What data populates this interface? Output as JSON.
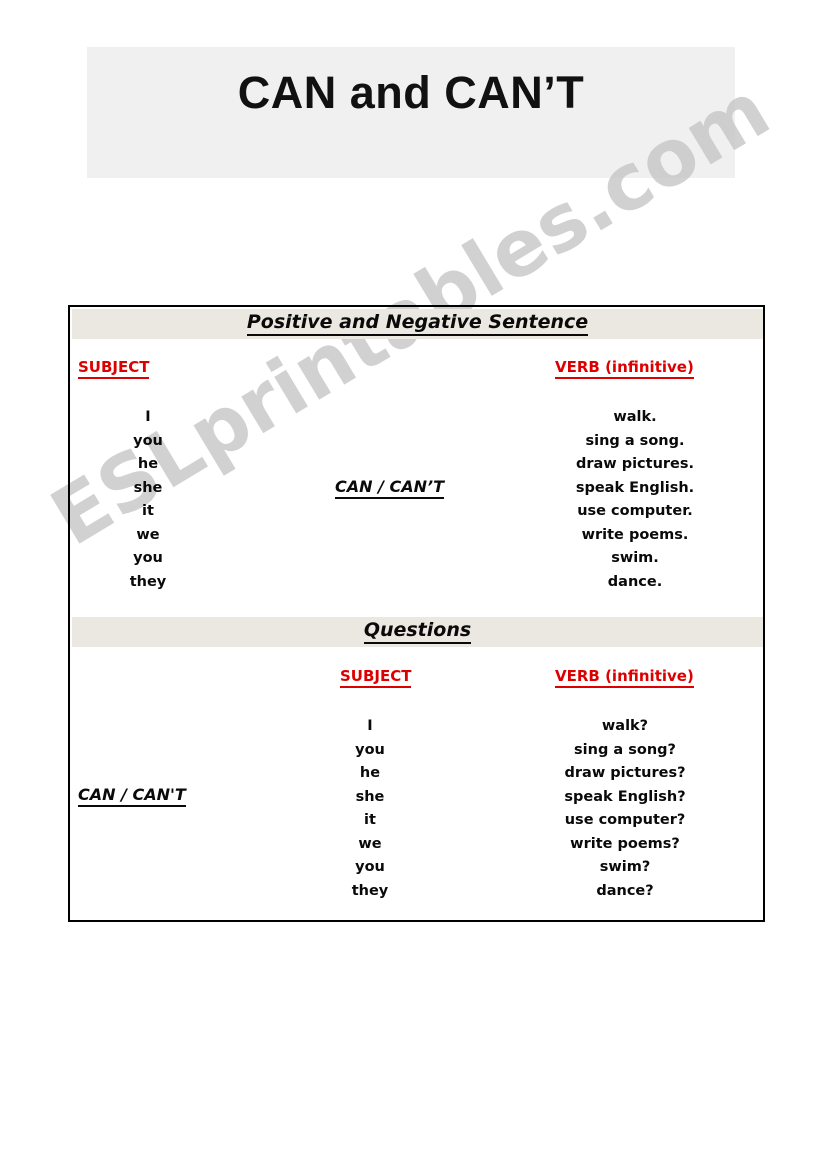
{
  "page": {
    "title": "CAN and CAN’T"
  },
  "watermark": {
    "text": "ESLprintables.com"
  },
  "colors": {
    "title_background": "#f0f0f0",
    "band_background": "#eae8e1",
    "header_red": "#dd0000",
    "text_black": "#0a0a0a",
    "watermark_gray": "#c9c9c9",
    "table_border": "#000000"
  },
  "table": {
    "sections": [
      {
        "id": "positive",
        "band_label": "Positive and Negative Sentence",
        "subject_header": "SUBJECT",
        "verb_header_main": "VERB",
        "verb_header_paren": "(infinitive)",
        "modal_label": "CAN / CAN’T",
        "subjects": [
          "I",
          "you",
          "he",
          "she",
          "it",
          "we",
          "you",
          "they"
        ],
        "verbs": [
          "walk.",
          "sing a song.",
          "draw pictures.",
          "speak English.",
          "use computer.",
          "write poems.",
          "swim.",
          "dance."
        ]
      },
      {
        "id": "questions",
        "band_label": "Questions",
        "subject_header": "SUBJECT",
        "verb_header_main": "VERB",
        "verb_header_paren": "(infinitive)",
        "modal_label": "CAN / CAN'T",
        "subjects": [
          "I",
          "you",
          "he",
          "she",
          "it",
          "we",
          "you",
          "they"
        ],
        "verbs": [
          "walk?",
          "sing a song?",
          "draw pictures?",
          "speak English?",
          "use computer?",
          "write poems?",
          "swim?",
          "dance?"
        ]
      }
    ]
  }
}
